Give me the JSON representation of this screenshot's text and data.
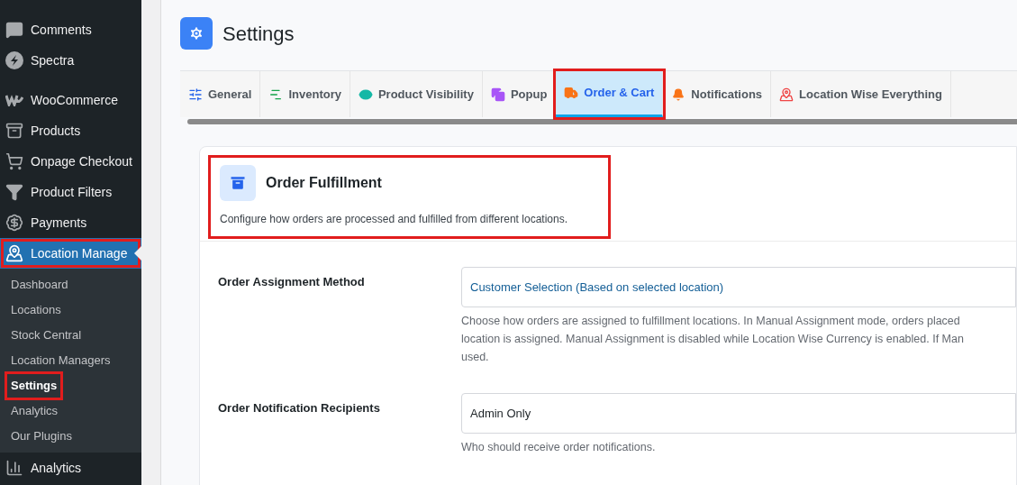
{
  "sidebar": {
    "items": [
      {
        "label": "Comments",
        "kind": "comments",
        "selected": false,
        "highlighted": false
      },
      {
        "label": "Spectra",
        "kind": "spectra",
        "selected": false,
        "highlighted": false
      },
      {
        "label": "WooCommerce",
        "kind": "woo",
        "selected": false,
        "highlighted": false
      },
      {
        "label": "Products",
        "kind": "products",
        "selected": false,
        "highlighted": false
      },
      {
        "label": "Onpage Checkout",
        "kind": "cart",
        "selected": false,
        "highlighted": false
      },
      {
        "label": "Product Filters",
        "kind": "filter",
        "selected": false,
        "highlighted": false
      },
      {
        "label": "Payments",
        "kind": "payments",
        "selected": false,
        "highlighted": false
      },
      {
        "label": "Location Manage",
        "kind": "map",
        "selected": true,
        "highlighted": true,
        "children": [
          {
            "label": "Dashboard",
            "selected": false,
            "highlighted": false
          },
          {
            "label": "Locations",
            "selected": false,
            "highlighted": false
          },
          {
            "label": "Stock Central",
            "selected": false,
            "highlighted": false
          },
          {
            "label": "Location Managers",
            "selected": false,
            "highlighted": false
          },
          {
            "label": "Settings",
            "selected": true,
            "highlighted": true
          },
          {
            "label": "Analytics",
            "selected": false,
            "highlighted": false
          },
          {
            "label": "Our Plugins",
            "selected": false,
            "highlighted": false
          }
        ]
      },
      {
        "label": "Analytics",
        "kind": "chart",
        "selected": false,
        "highlighted": false
      }
    ]
  },
  "page": {
    "title": "Settings"
  },
  "tabs": [
    {
      "label": "General",
      "kind": "sliders",
      "color": "#2563eb",
      "selected": false,
      "highlighted": false
    },
    {
      "label": "Inventory",
      "kind": "inventory",
      "color": "#16a34a",
      "selected": false,
      "highlighted": false
    },
    {
      "label": "Product Visibility",
      "kind": "eye",
      "color": "#14b8a6",
      "selected": false,
      "highlighted": false
    },
    {
      "label": "Popup",
      "kind": "popup",
      "color": "#a855f7",
      "selected": false,
      "highlighted": false
    },
    {
      "label": "Order & Cart",
      "kind": "truck",
      "color": "#f97316",
      "selected": true,
      "highlighted": true
    },
    {
      "label": "Notifications",
      "kind": "bell",
      "color": "#f97316",
      "selected": false,
      "highlighted": false
    },
    {
      "label": "Location Wise Everything",
      "kind": "mappin",
      "color": "#ef4444",
      "selected": false,
      "highlighted": false
    }
  ],
  "section": {
    "title": "Order Fulfillment",
    "description": "Configure how orders are processed and fulfilled from different locations.",
    "highlighted": true,
    "fields": [
      {
        "label": "Order Assignment Method",
        "value": "Customer Selection (Based on selected location)",
        "help": [
          "Choose how orders are assigned to fulfillment locations. In Manual Assignment mode, orders placed",
          "location is assigned. Manual Assignment is disabled while Location Wise Currency is enabled. If Man",
          "used."
        ]
      },
      {
        "label": "Order Notification Recipients",
        "value": "Admin Only",
        "help": [
          "Who should receive order notifications."
        ]
      }
    ]
  }
}
